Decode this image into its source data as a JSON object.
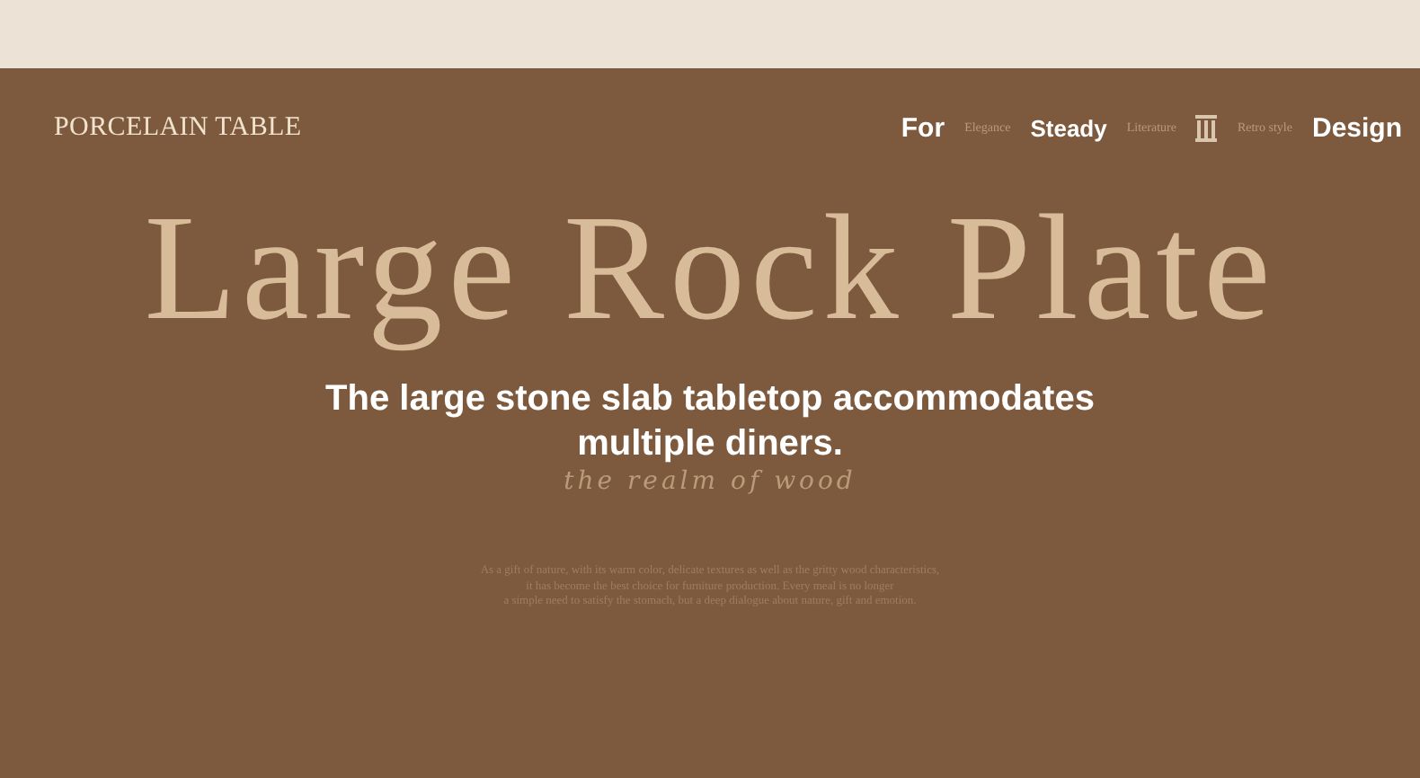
{
  "brand": "PORCELAIN TABLE",
  "nav": [
    {
      "label": "For",
      "kind": "major"
    },
    {
      "label": "Elegance",
      "kind": "minor"
    },
    {
      "label": "Steady",
      "kind": "major"
    },
    {
      "label": "Literature",
      "kind": "minor"
    },
    {
      "kind": "icon"
    },
    {
      "label": "Retro style",
      "kind": "minor"
    },
    {
      "label": "Design",
      "kind": "major"
    }
  ],
  "title": "Large Rock Plate",
  "subtitle": "The large stone slab tabletop accommodates multiple diners.",
  "script_line": "the realm of wood",
  "paragraph": [
    "As a gift of nature, with its warm color, delicate textures as well as the gritty wood characteristics,",
    "it has become the best choice for furniture production. Every meal is no longer",
    "a simple need to satisfy the stomach, but a deep dialogue about nature, gift and emotion."
  ]
}
